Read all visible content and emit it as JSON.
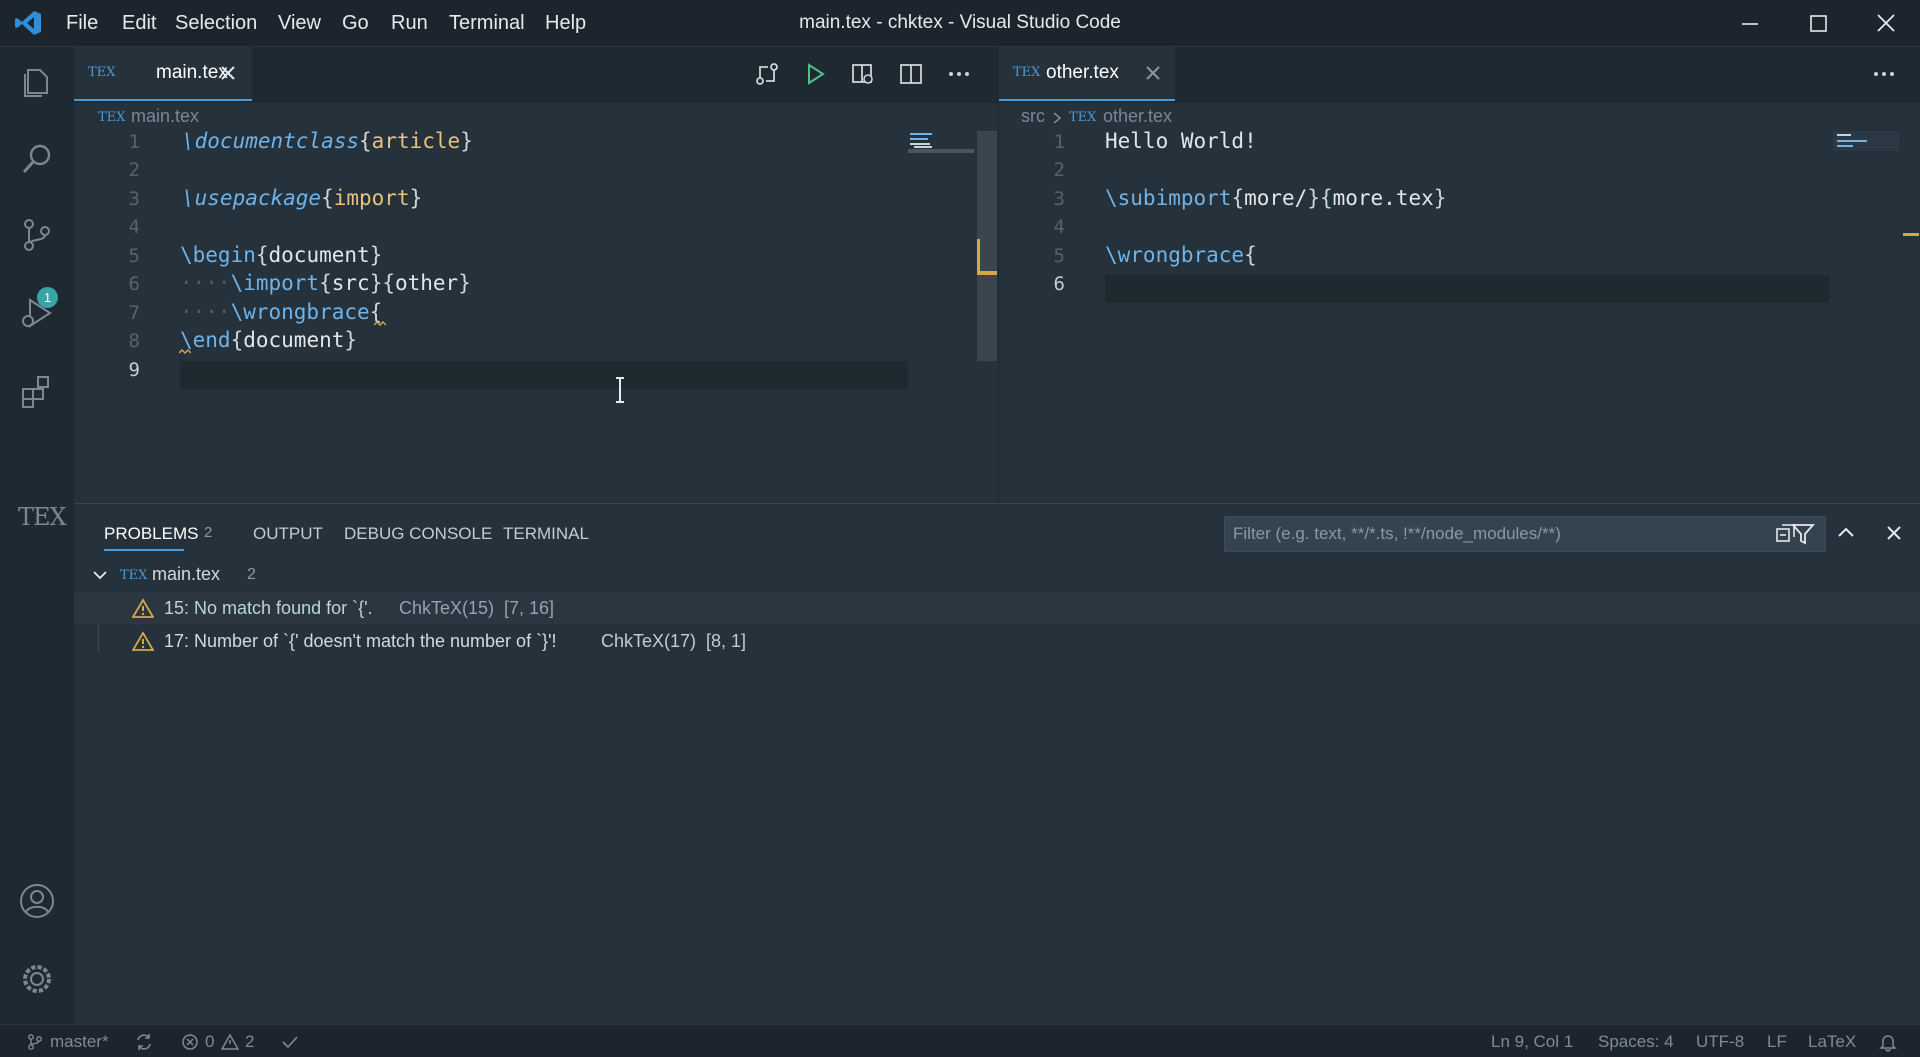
{
  "window": {
    "title": "main.tex - chktex - Visual Studio Code",
    "menu": [
      "File",
      "Edit",
      "Selection",
      "View",
      "Go",
      "Run",
      "Terminal",
      "Help"
    ]
  },
  "activity": {
    "icons": [
      "explorer-icon",
      "search-icon",
      "source-control-icon",
      "run-debug-icon",
      "extensions-icon",
      "latex-icon",
      "account-icon",
      "settings-gear-icon"
    ],
    "scm_badge": "1",
    "tex_label": "TEX"
  },
  "left_editor": {
    "tab_label": "main.tex",
    "tex_badge": "TEX",
    "breadcrumb": "main.tex",
    "line_numbers": [
      "1",
      "2",
      "3",
      "4",
      "5",
      "6",
      "7",
      "8",
      "9"
    ],
    "current_line": "9"
  },
  "right_editor": {
    "tab_label": "other.tex",
    "tex_badge": "TEX",
    "breadcrumb_folder": "src",
    "breadcrumb_file": "other.tex",
    "line_numbers": [
      "1",
      "2",
      "3",
      "4",
      "5",
      "6"
    ],
    "current_line": "6"
  },
  "panel": {
    "tabs": [
      "PROBLEMS",
      "OUTPUT",
      "DEBUG CONSOLE",
      "TERMINAL"
    ],
    "problems_count": "2",
    "filter_placeholder": "Filter (e.g. text, **/*.ts, !**/node_modules/**)",
    "file_group": {
      "name": "main.tex",
      "count": "2"
    },
    "problems": [
      {
        "message": "15: No match found for `{'.",
        "source": "ChkTeX(15)",
        "position": "[7, 16]"
      },
      {
        "message": "17: Number of `{' doesn't match the number of `}'!",
        "source": "ChkTeX(17)",
        "position": "[8, 1]"
      }
    ]
  },
  "status": {
    "branch": "master*",
    "errors": "0",
    "warnings": "2",
    "cursor": "Ln 9, Col 1",
    "spaces": "Spaces: 4",
    "encoding": "UTF-8",
    "eol": "LF",
    "language": "LaTeX"
  },
  "colors": {
    "accent": "#4b9ad8",
    "warning": "#d7a54b",
    "keyword": "#6fb3e8",
    "argument": "#e8c17d"
  }
}
